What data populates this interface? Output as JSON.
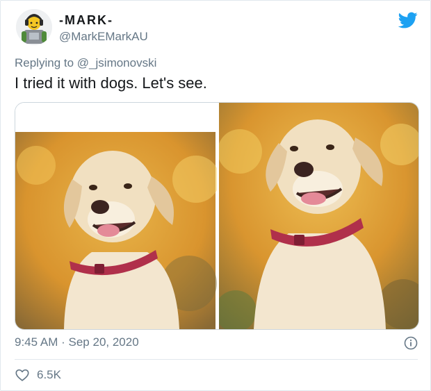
{
  "author": {
    "display_name": "-MARK-",
    "handle": "@MarkEMarkAU",
    "avatar_icon": "lego-minifigure-avatar"
  },
  "reply": {
    "prefix": "Replying to",
    "mention": "@_jsimonovski"
  },
  "tweet_text": "I tried it with dogs. Let's see.",
  "media": {
    "left_image": "labrador-dog-photo-cropped",
    "right_image": "labrador-dog-photo-full"
  },
  "timestamp": {
    "time": "9:45 AM",
    "separator": "·",
    "date": "Sep 20, 2020"
  },
  "likes": {
    "count": "6.5K"
  },
  "colors": {
    "brand": "#1da1f2",
    "secondary_text": "#657786",
    "primary_text": "#14171a",
    "border": "#e1e8ed"
  }
}
